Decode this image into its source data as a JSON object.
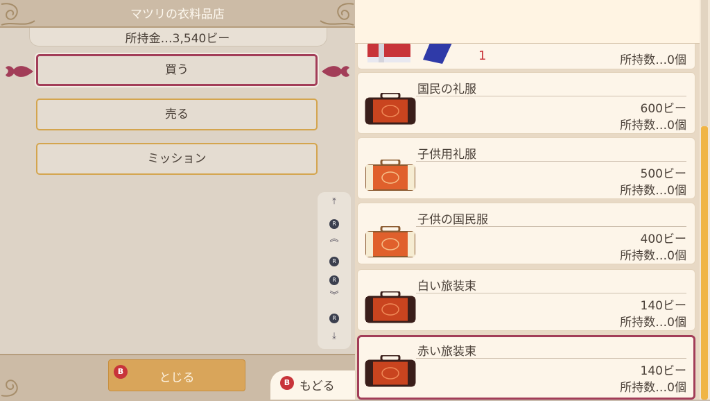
{
  "shop": {
    "title": "マツリの衣料品店",
    "money": "所持金…3,540ビー"
  },
  "menu": {
    "items": [
      {
        "label": "買う",
        "selected": true
      },
      {
        "label": "売る",
        "selected": false
      },
      {
        "label": "ミッション",
        "selected": false
      }
    ]
  },
  "close": {
    "button_glyph": "B",
    "label": "とじる"
  },
  "back": {
    "button_glyph": "B",
    "label": "もどる"
  },
  "scroll_hints": {
    "r_glyph": "R"
  },
  "items": {
    "partial": {
      "quantity": "1",
      "owned": "所持数…0個"
    },
    "list": [
      {
        "name": "国民の礼服",
        "price": "600ビー",
        "owned": "所持数…0個",
        "case_color": "dark",
        "selected": false
      },
      {
        "name": "子供用礼服",
        "price": "500ビー",
        "owned": "所持数…0個",
        "case_color": "light",
        "selected": false
      },
      {
        "name": "子供の国民服",
        "price": "400ビー",
        "owned": "所持数…0個",
        "case_color": "light",
        "selected": false
      },
      {
        "name": "白い旅装束",
        "price": "140ビー",
        "owned": "所持数…0個",
        "case_color": "dark",
        "selected": false
      },
      {
        "name": "赤い旅装束",
        "price": "140ビー",
        "owned": "所持数…0個",
        "case_color": "dark",
        "selected": true
      }
    ]
  },
  "colors": {
    "accent_selected": "#a23d58",
    "button_border": "#d4a54e",
    "scrollbar": "#f0b545",
    "quantity_red": "#c8343a"
  }
}
